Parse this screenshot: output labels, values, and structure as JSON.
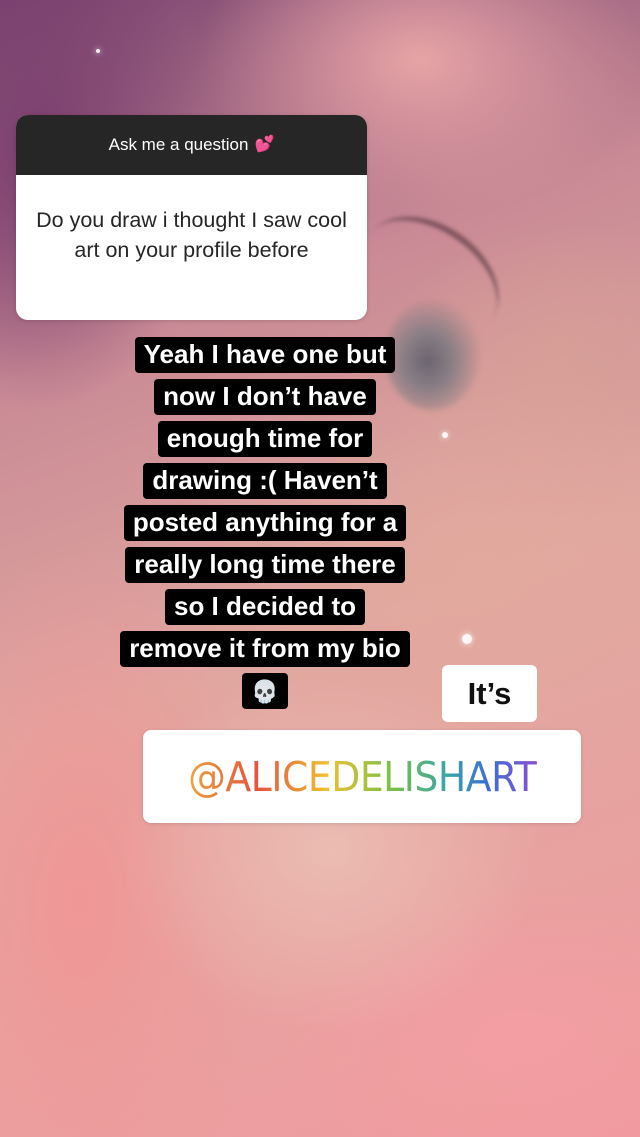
{
  "question_sticker": {
    "header": "Ask me a question",
    "header_icon": "sparkling-hearts-emoji",
    "header_emoji": "💕",
    "question": "Do you draw i thought I saw cool art on your profile before"
  },
  "answer": {
    "lines": [
      "Yeah I have one but",
      "now I don’t have",
      "enough time for",
      "drawing :( Haven’t",
      "posted anything for a",
      "really long time there",
      "so I decided to",
      "remove it from my bio"
    ],
    "trailing_icon": "skull-emoji",
    "trailing_emoji": "💀"
  },
  "its_sticker": {
    "text": "It’s"
  },
  "mention_sticker": {
    "text": "@ALICEDELISHART"
  }
}
